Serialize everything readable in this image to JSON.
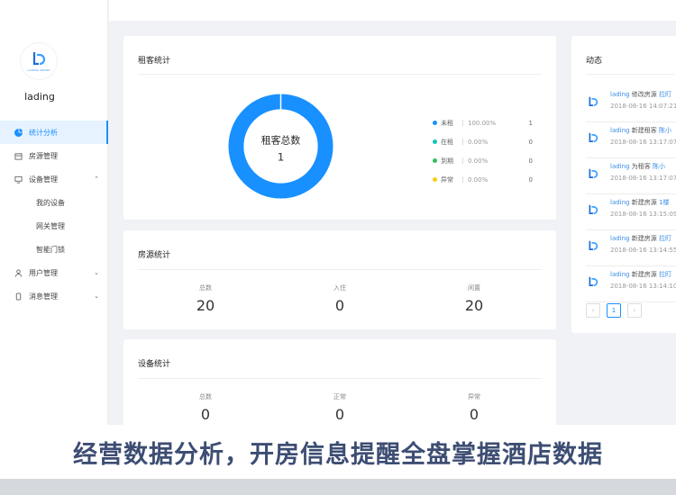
{
  "sidebar": {
    "brand": "lading",
    "logo_text": "LADING SMART",
    "items": [
      {
        "label": "统计分析",
        "icon": "pie-chart-icon",
        "active": true
      },
      {
        "label": "房源管理",
        "icon": "house-icon"
      },
      {
        "label": "设备管理",
        "icon": "monitor-icon",
        "expanded": true
      },
      {
        "label": "我的设备",
        "sub": true
      },
      {
        "label": "网关管理",
        "sub": true
      },
      {
        "label": "智能门锁",
        "sub": true
      },
      {
        "label": "用户管理",
        "icon": "user-icon"
      },
      {
        "label": "消息管理",
        "icon": "bell-icon"
      }
    ]
  },
  "tenant": {
    "title": "租客统计",
    "center_label": "租客总数",
    "center_value": "1",
    "legend": [
      {
        "name": "未租",
        "pct": "100.00%",
        "value": "1",
        "color": "#1890ff"
      },
      {
        "name": "在租",
        "pct": "0.00%",
        "value": "0",
        "color": "#13c2c2"
      },
      {
        "name": "到期",
        "pct": "0.00%",
        "value": "0",
        "color": "#2fc25b"
      },
      {
        "name": "异常",
        "pct": "0.00%",
        "value": "0",
        "color": "#facc14"
      }
    ]
  },
  "house": {
    "title": "房源统计",
    "stats": [
      {
        "label": "总数",
        "value": "20"
      },
      {
        "label": "入住",
        "value": "0"
      },
      {
        "label": "闲置",
        "value": "20"
      }
    ]
  },
  "device": {
    "title": "设备统计",
    "stats": [
      {
        "label": "总数",
        "value": "0"
      },
      {
        "label": "正常",
        "value": "0"
      },
      {
        "label": "异常",
        "value": "0"
      }
    ]
  },
  "activity": {
    "title": "动态",
    "items": [
      {
        "user": "lading",
        "action": "修改房源",
        "target": "拉盯",
        "time": "2018-08-16 14:07:21"
      },
      {
        "user": "lading",
        "action": "新建租客",
        "target": "陈小",
        "time": "2018-08-16 13:17:07"
      },
      {
        "user": "lading",
        "action": "为租客",
        "target": "陈小",
        "time": "2018-08-16 13:17:07"
      },
      {
        "user": "lading",
        "action": "新建房源",
        "target": "1楼",
        "time": "2018-08-16 13:15:09"
      },
      {
        "user": "lading",
        "action": "新建房源",
        "target": "拉盯",
        "time": "2018-08-16 13:14:55"
      },
      {
        "user": "lading",
        "action": "新建房源",
        "target": "拉盯",
        "time": "2018-08-16 13:14:10"
      }
    ],
    "pager": {
      "prev": "‹",
      "current": "1",
      "next": "›"
    }
  },
  "banner": "经营数据分析，开房信息提醒全盘掌握酒店数据"
}
